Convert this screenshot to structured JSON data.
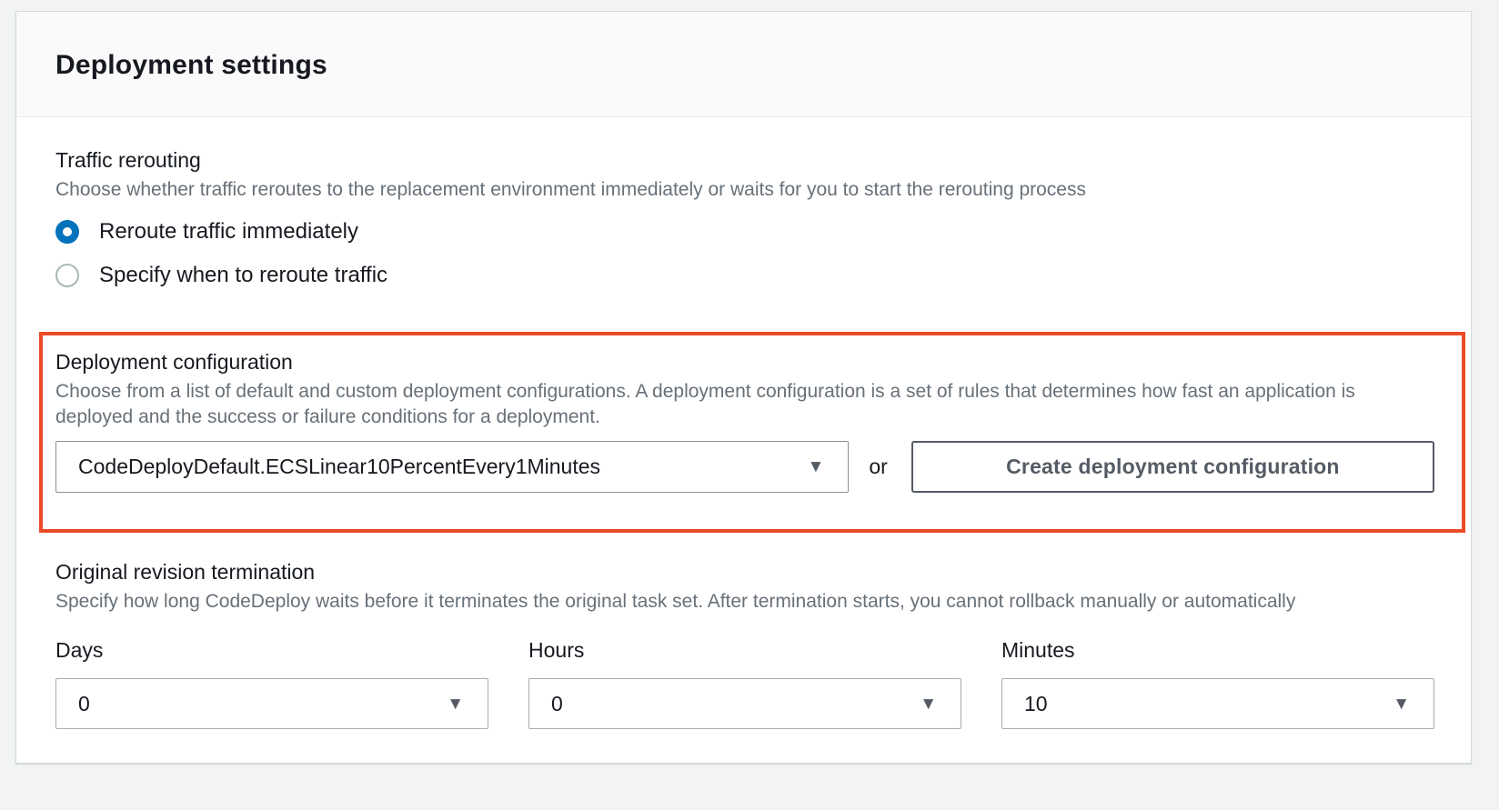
{
  "panel": {
    "title": "Deployment settings"
  },
  "traffic_rerouting": {
    "label": "Traffic rerouting",
    "description": "Choose whether traffic reroutes to the replacement environment immediately or waits for you to start the rerouting process",
    "options": [
      {
        "label": "Reroute traffic immediately",
        "selected": true
      },
      {
        "label": "Specify when to reroute traffic",
        "selected": false
      }
    ]
  },
  "deployment_configuration": {
    "label": "Deployment configuration",
    "description": "Choose from a list of default and custom deployment configurations. A deployment configuration is a set of rules that determines how fast an application is deployed and the success or failure conditions for a deployment.",
    "select_value": "CodeDeployDefault.ECSLinear10PercentEvery1Minutes",
    "or_label": "or",
    "create_button_label": "Create deployment configuration"
  },
  "original_revision_termination": {
    "label": "Original revision termination",
    "description": "Specify how long CodeDeploy waits before it terminates the original task set. After termination starts, you cannot rollback manually or automatically",
    "fields": [
      {
        "label": "Days",
        "value": "0"
      },
      {
        "label": "Hours",
        "value": "0"
      },
      {
        "label": "Minutes",
        "value": "10"
      }
    ]
  },
  "icons": {
    "caret_down": "▼"
  },
  "colors": {
    "highlight_border": "#eb4b28",
    "radio_selected": "#0073bb",
    "page_background": "#f2f3f3",
    "secondary_text": "#687078",
    "button_gray": "#545b64"
  }
}
